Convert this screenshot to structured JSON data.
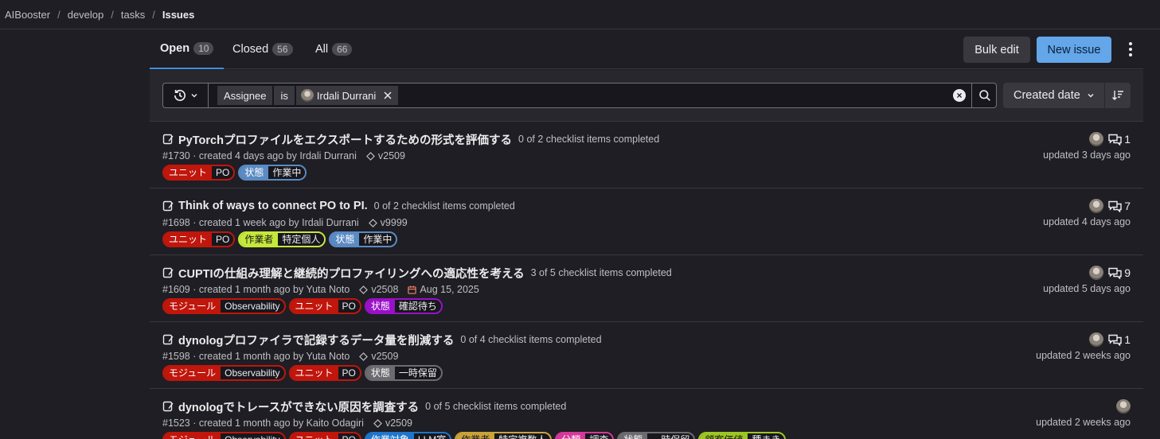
{
  "breadcrumb": [
    "AIBooster",
    "develop",
    "tasks",
    "Issues"
  ],
  "tabs": [
    {
      "label": "Open",
      "count": "10"
    },
    {
      "label": "Closed",
      "count": "56"
    },
    {
      "label": "All",
      "count": "66"
    }
  ],
  "toolbar": {
    "bulk_edit": "Bulk edit",
    "new_issue": "New issue"
  },
  "filter": {
    "token_field": "Assignee",
    "token_operator": "is",
    "token_value": "Irdali Durrani",
    "sort_label": "Created date"
  },
  "colors": {
    "unit": "#c0160c",
    "status_blue": "#5a8bc4",
    "worker": "#c6e83a",
    "status_purple": "#9b10c9",
    "status_gray": "#6c6b70",
    "module": "#c0160c",
    "accent": "#63a6e9"
  },
  "issues": [
    {
      "title": "PyTorchプロファイルをエクスポートするための形式を評価する",
      "checklist": "0 of 2 checklist items completed",
      "meta": "#1730 · created 4 days ago by Irdali Durrani",
      "milestone": "v2509",
      "due": "",
      "comments": "1",
      "updated": "updated 3 days ago",
      "labels": [
        {
          "k": "ユニット",
          "v": "PO",
          "color": "#c0160c"
        },
        {
          "k": "状態",
          "v": "作業中",
          "color": "#5a8bc4"
        }
      ]
    },
    {
      "title": "Think of ways to connect PO to PI.",
      "checklist": "0 of 2 checklist items completed",
      "meta": "#1698 · created 1 week ago by Irdali Durrani",
      "milestone": "v9999",
      "due": "",
      "comments": "7",
      "updated": "updated 4 days ago",
      "labels": [
        {
          "k": "ユニット",
          "v": "PO",
          "color": "#c0160c"
        },
        {
          "k": "作業者",
          "v": "特定個人",
          "color": "#c6e83a"
        },
        {
          "k": "状態",
          "v": "作業中",
          "color": "#5a8bc4"
        }
      ]
    },
    {
      "title": "CUPTIの仕組み理解と継続的プロファイリングへの適応性を考える",
      "checklist": "3 of 5 checklist items completed",
      "meta": "#1609 · created 1 month ago by Yuta Noto",
      "milestone": "v2508",
      "due": "Aug 15, 2025",
      "comments": "9",
      "updated": "updated 5 days ago",
      "labels": [
        {
          "k": "モジュール",
          "v": "Observability",
          "color": "#c0160c"
        },
        {
          "k": "ユニット",
          "v": "PO",
          "color": "#c0160c"
        },
        {
          "k": "状態",
          "v": "確認待ち",
          "color": "#9b10c9"
        }
      ]
    },
    {
      "title": "dynologプロファイラで記録するデータ量を削減する",
      "checklist": "0 of 4 checklist items completed",
      "meta": "#1598 · created 1 month ago by Yuta Noto",
      "milestone": "v2509",
      "due": "",
      "comments": "1",
      "updated": "updated 2 weeks ago",
      "labels": [
        {
          "k": "モジュール",
          "v": "Observability",
          "color": "#c0160c"
        },
        {
          "k": "ユニット",
          "v": "PO",
          "color": "#c0160c"
        },
        {
          "k": "状態",
          "v": "一時保留",
          "color": "#6c6b70"
        }
      ]
    },
    {
      "title": "dynologでトレースができない原因を調査する",
      "checklist": "0 of 5 checklist items completed",
      "meta": "#1523 · created 1 month ago by Kaito Odagiri",
      "milestone": "v2509",
      "due": "",
      "comments": "",
      "updated": "updated 2 weeks ago",
      "labels": [
        {
          "k": "モジュール",
          "v": "Observability",
          "color": "#c0160c"
        },
        {
          "k": "ユニット",
          "v": "PO",
          "color": "#c0160c"
        },
        {
          "k": "作業対象",
          "v": "LLM室",
          "color": "#1f75cb"
        },
        {
          "k": "作業者",
          "v": "特定複数人",
          "color": "#c9a33a"
        },
        {
          "k": "分類",
          "v": "調査",
          "color": "#d6389a"
        },
        {
          "k": "状態",
          "v": "一時保留",
          "color": "#6c6b70"
        },
        {
          "k": "顧客価値",
          "v": "種まき",
          "color": "#9cc622"
        }
      ]
    }
  ]
}
